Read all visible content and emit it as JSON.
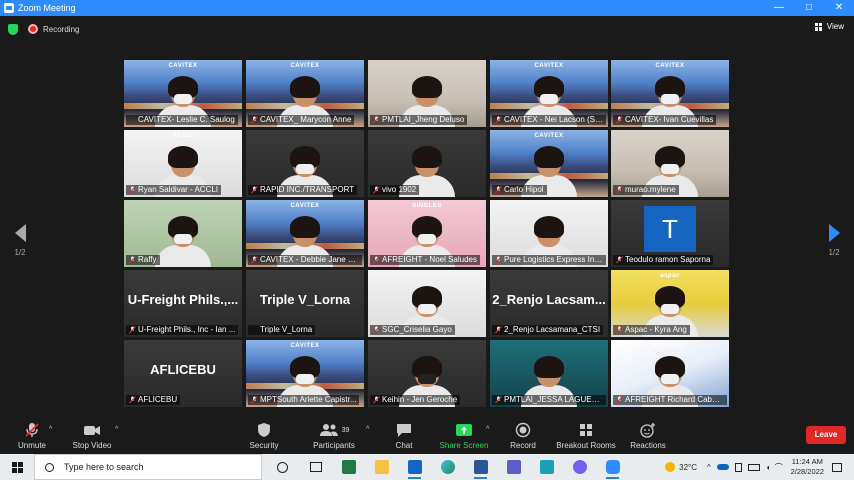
{
  "window": {
    "title": "Zoom Meeting",
    "controls": [
      "—",
      "□",
      "✕"
    ]
  },
  "meeting": {
    "recording_label": "Recording",
    "view_label": "View"
  },
  "pagination": {
    "left": "1/2",
    "right": "1/2"
  },
  "tiles": [
    {
      "name": "CAVITEX- Leslie C. Saulog",
      "muted": false,
      "active": true,
      "bg": "city",
      "logo": "CAVITEX"
    },
    {
      "name": "CAVITEX_ Marycon Anne",
      "muted": true,
      "bg": "city",
      "logo": "CAVITEX"
    },
    {
      "name": "PMTLAI_Jheng Deluso",
      "muted": true,
      "bg": "room"
    },
    {
      "name": "CAVITEX - Nei Lacson (St...",
      "muted": true,
      "bg": "city",
      "logo": "CAVITEX"
    },
    {
      "name": "CAVITEX- Ivan Cuevillas",
      "muted": true,
      "bg": "city",
      "logo": "CAVITEX"
    },
    {
      "name": "Ryan Saldivar - ACCLI",
      "muted": true,
      "bg": "white",
      "logo": "ACCLI"
    },
    {
      "name": "RAPID INC./TRANSPORT",
      "muted": true,
      "bg": "dark"
    },
    {
      "name": "vivo 1902",
      "muted": true,
      "bg": "dark"
    },
    {
      "name": "Carlo Hipol",
      "muted": true,
      "bg": "city",
      "logo": "CAVITEX"
    },
    {
      "name": "murao.mylene",
      "muted": true,
      "bg": "room"
    },
    {
      "name": "Raffy",
      "muted": true,
      "bg": "green"
    },
    {
      "name": "CAVITEX - Debbie Jane B...",
      "muted": true,
      "bg": "city",
      "logo": "CAVITEX"
    },
    {
      "name": "AFREIGHT - Noel Saludes",
      "muted": true,
      "bg": "pink",
      "logo": "SINGLES"
    },
    {
      "name": "Pure Logistics Express Inc...",
      "muted": true,
      "bg": "white"
    },
    {
      "name": "Teodulo ramon Saporna",
      "muted": true,
      "bg": "dark",
      "avatar": "T"
    },
    {
      "name": "U-Freight Phils., Inc - Ian ...",
      "muted": true,
      "bg": "dark",
      "big": "U-Freight Phils.,..."
    },
    {
      "name": "Triple V_Lorna",
      "muted": false,
      "bg": "dark",
      "big": "Triple V_Lorna"
    },
    {
      "name": "SGC_Criselia Gayo",
      "muted": true,
      "bg": "white"
    },
    {
      "name": "2_Renjo Lacsamana_CTSI",
      "muted": true,
      "bg": "dark",
      "big": "2_Renjo  Lacsam..."
    },
    {
      "name": "Aspac - Kyra Ang",
      "muted": true,
      "bg": "yellow",
      "logo": "aspac"
    },
    {
      "name": "AFLICEBU",
      "muted": true,
      "bg": "dark",
      "big": "AFLICEBU"
    },
    {
      "name": "MPTSouth Arlette Capistr...",
      "muted": true,
      "bg": "city",
      "logo": "CAVITEX"
    },
    {
      "name": "Keihin - Jen Geroche",
      "muted": true,
      "bg": "dark"
    },
    {
      "name": "PMTLAI_JESSA LAGUERTA",
      "muted": true,
      "bg": "teal"
    },
    {
      "name": "AFREIGHT Richard Caban...",
      "muted": true,
      "bg": "blue-office",
      "logo": "AFREIGHT"
    }
  ],
  "toolbar": {
    "unmute": "Unmute",
    "stop_video": "Stop Video",
    "security": "Security",
    "participants": "Participants",
    "participants_count": "39",
    "chat": "Chat",
    "share_screen": "Share Screen",
    "record": "Record",
    "breakout_rooms": "Breakout Rooms",
    "reactions": "Reactions",
    "leave": "Leave"
  },
  "taskbar": {
    "search_placeholder": "Type here to search",
    "weather": "32°C",
    "time": "11:24 AM",
    "date": "2/28/2022"
  },
  "colors": {
    "accent": "#2d8cff",
    "leave": "#e02828",
    "share": "#23d959",
    "active_speaker": "#e5e04b"
  }
}
